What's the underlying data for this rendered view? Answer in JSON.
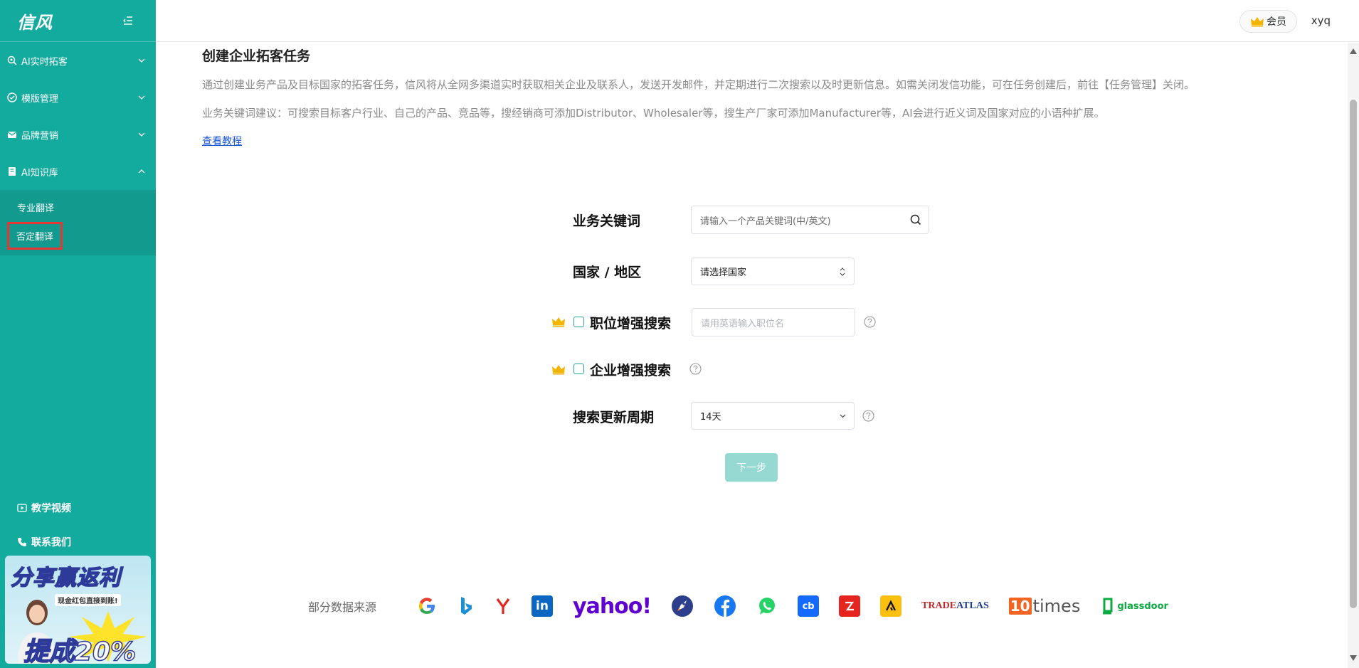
{
  "sidebar": {
    "logo": "信风",
    "menu": [
      {
        "label": "AI实时拓客",
        "icon": "search-target-icon"
      },
      {
        "label": "模版管理",
        "icon": "template-icon"
      },
      {
        "label": "品牌营销",
        "icon": "mail-icon"
      },
      {
        "label": "AI知识库",
        "icon": "book-icon",
        "expanded": true
      }
    ],
    "submenu": [
      "专业翻译",
      "否定翻译"
    ],
    "active_sub": "否定翻译",
    "bottom_links": [
      "教学视频",
      "联系我们"
    ],
    "promo": {
      "title": "分享赢返利",
      "subtitle": "现金红包直接到账!",
      "percent_text": "提成20%"
    }
  },
  "topbar": {
    "member_label": "会员",
    "username": "xyq"
  },
  "main": {
    "title": "创建企业拓客任务",
    "desc1": "通过创建业务产品及目标国家的拓客任务，信风将从全网多渠道实时获取相关企业及联系人，发送开发邮件，并定期进行二次搜索以及时更新信息。如需关闭发信功能，可在任务创建后，前往【任务管理】关闭。",
    "desc2": "业务关键词建议：可搜索目标客户行业、自己的产品、竞品等，搜经销商可添加Distributor、Wholesaler等，搜生产厂家可添加Manufacturer等，AI会进行近义词及国家对应的小语种扩展。",
    "tutorial_link": "查看教程"
  },
  "form": {
    "keyword_label": "业务关键词",
    "keyword_placeholder": "请输入一个产品关键词(中/英文)",
    "country_label": "国家 / 地区",
    "country_placeholder": "请选择国家",
    "position_label": "职位增强搜索",
    "position_placeholder": "请用英语输入职位名",
    "company_label": "企业增强搜索",
    "cycle_label": "搜索更新周期",
    "cycle_value": "14天",
    "next_button": "下一步"
  },
  "sources": {
    "label": "部分数据来源",
    "logos": [
      "google",
      "bing",
      "yandex",
      "linkedin",
      "yahoo!",
      "rocket",
      "facebook",
      "whatsapp",
      "crunchbase",
      "zoominfo",
      "apollo",
      "TRADEATLAS",
      "10times",
      "glassdoor"
    ]
  },
  "colors": {
    "brand": "#14ab9f",
    "button_disabled": "#96d9d3",
    "link": "#1a55d8",
    "crown": "#f5b400"
  }
}
